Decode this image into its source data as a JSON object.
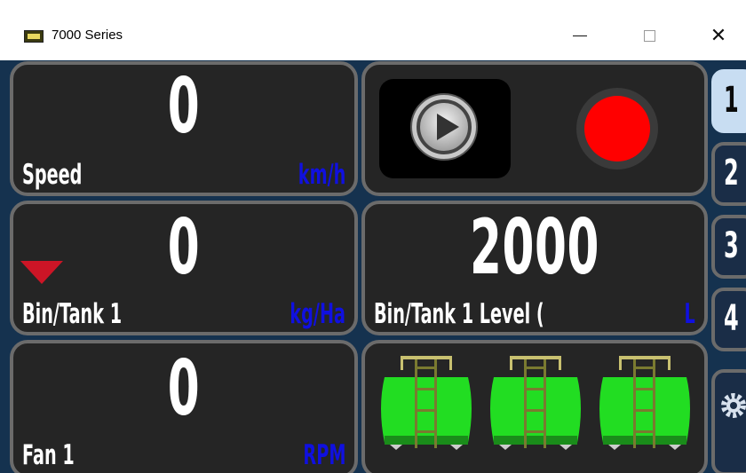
{
  "window": {
    "title": "7000 Series",
    "minimize_glyph": "—",
    "close_glyph": "✕"
  },
  "tiles": {
    "speed": {
      "value": "0",
      "label": "Speed",
      "unit": "km/h"
    },
    "bin_tank_rate": {
      "value": "0",
      "label": "Bin/Tank 1",
      "unit": "kg/Ha"
    },
    "fan": {
      "value": "0",
      "label": "Fan 1",
      "unit": "RPM"
    },
    "bin_tank_level": {
      "value": "2000",
      "label": "Bin/Tank 1 Level (",
      "unit": "L"
    }
  },
  "controls": {
    "play_icon": "play-icon",
    "record_icon": "record-icon"
  },
  "tanks": {
    "count": 3,
    "color": "#22dd22",
    "fill_fraction": 1.0
  },
  "side_tabs": [
    {
      "label": "1",
      "active": true
    },
    {
      "label": "2",
      "active": false
    },
    {
      "label": "3",
      "active": false
    },
    {
      "label": "4",
      "active": false
    }
  ],
  "settings_tab": {
    "icon": "gear-icon"
  },
  "colors": {
    "background": "#15324f",
    "tile": "#252525",
    "tile_border": "#6b6b6b",
    "value_text": "#ffffff",
    "unit_text": "#1010e0",
    "record_red": "#ff0000",
    "alarm_triangle": "#cc1526",
    "active_tab": "#c8ddf2"
  }
}
